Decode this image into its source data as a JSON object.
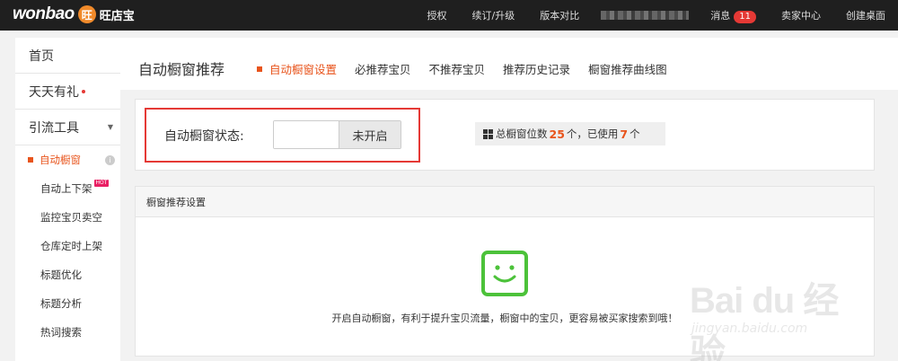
{
  "topbar": {
    "logo_text": "wonbao",
    "logo_badge": "旺",
    "logo_cn": "旺店宝",
    "nav": [
      "授权",
      "续订/升级",
      "版本对比"
    ],
    "messages_label": "消息",
    "messages_count": "11",
    "seller_center": "卖家中心",
    "create_desktop": "创建桌面"
  },
  "sidebar": {
    "home": "首页",
    "daily_gift": "天天有礼",
    "traffic_tools": "引流工具",
    "items": [
      {
        "label": "自动橱窗",
        "active": true
      },
      {
        "label": "自动上下架",
        "badge": "HOT"
      },
      {
        "label": "监控宝贝卖空"
      },
      {
        "label": "仓库定时上架"
      },
      {
        "label": "标题优化"
      },
      {
        "label": "标题分析"
      },
      {
        "label": "热词搜索"
      }
    ]
  },
  "header": {
    "title": "自动橱窗推荐",
    "tabs": [
      {
        "label": "自动橱窗设置",
        "active": true
      },
      {
        "label": "必推荐宝贝"
      },
      {
        "label": "不推荐宝贝"
      },
      {
        "label": "推荐历史记录"
      },
      {
        "label": "橱窗推荐曲线图"
      }
    ]
  },
  "status": {
    "label": "自动橱窗状态:",
    "toggle_value": "未开启",
    "count_prefix": "总橱窗位数",
    "total": "25",
    "count_mid": "个，已使用",
    "used": "7",
    "count_suffix": "个"
  },
  "settings": {
    "heading": "橱窗推荐设置",
    "hint": "开启自动橱窗，有利于提升宝贝流量，橱窗中的宝贝，更容易被买家搜索到哦！"
  },
  "watermark": {
    "brand": "Bai du 经验",
    "url": "jingyan.baidu.com"
  },
  "colors": {
    "accent": "#e8541c",
    "alert_border": "#e53935",
    "smiley_green": "#4cc23a",
    "topbar_bg": "#1f1f1f"
  }
}
